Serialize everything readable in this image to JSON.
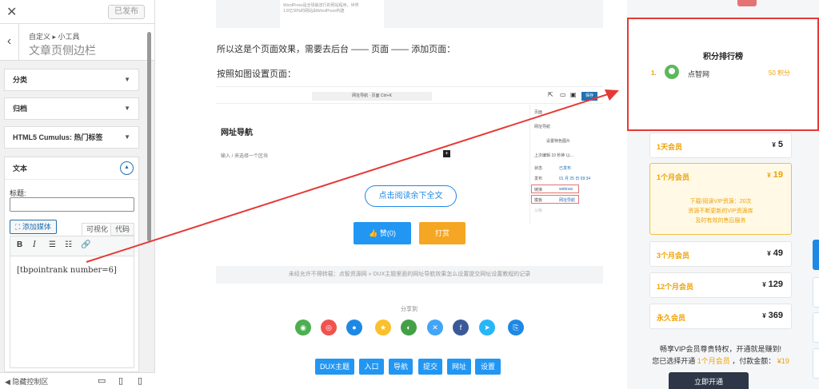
{
  "customizer": {
    "publish": "已发布",
    "breadcrumb": "自定义 ▸ 小工具",
    "title": "文章页侧边栏",
    "sections": [
      {
        "label": "分类"
      },
      {
        "label": "归档"
      },
      {
        "label": "HTML5 Cumulus: 热门标签"
      }
    ],
    "widget": {
      "name": "文本",
      "title_label": "标题:",
      "title_value": "",
      "add_media": "添加媒体",
      "tab_visual": "可视化",
      "tab_code": "代码",
      "content": "[tbpointrank number=6]"
    },
    "hide_controls": "隐藏控制区"
  },
  "article": {
    "snippet_line1": "WordPress是全球最流行的网站程序，世界",
    "snippet_line2": "1.8亿30%的网站由WordPress构建",
    "para1": "所以这是个页面效果，需要去后台 —— 页面 —— 添加页面：",
    "para2": "按照如图设置页面：",
    "shot": {
      "topbar": "网址导航 · 页面          Ctrl+K",
      "save": "保存",
      "page_title": "网址导航",
      "hint": "输入 / 来选择一个区块",
      "side_lines": [
        "页面",
        "网址导航",
        "设置特色图片",
        "上次编辑 10 秒钟 以...",
        "状态",
        "发布",
        "链接",
        "模板",
        "父级"
      ],
      "side_values": [
        "",
        "",
        "",
        "",
        "已发布",
        "01 月 25 日 09:34",
        "webnav",
        "网址导航",
        ""
      ]
    },
    "read_more": "点击阅读余下全文",
    "like": "赞(0)",
    "reward": "打赏",
    "notice": "未经允许不得转载：点智资源网 » DUX主题里面的网址导航效果怎么设置提交网址设置教程的记录",
    "share_label": "分享到",
    "tags": [
      "DUX主题",
      "入口",
      "导航",
      "提交",
      "网址",
      "设置"
    ]
  },
  "sidebar": {
    "rank_title": "积分排行榜",
    "rank_items": [
      {
        "num": "1.",
        "name": "点智网",
        "points": "50 积分"
      }
    ],
    "plans": [
      {
        "name": "1天会员",
        "price": "5"
      },
      {
        "name": "1个月会员",
        "price": "19",
        "desc": [
          "下载/阅读VIP资源：20次",
          "资源不断更新的VIP资源库",
          "及时有效的售后服务"
        ]
      },
      {
        "name": "3个月会员",
        "price": "49"
      },
      {
        "name": "12个月会员",
        "price": "129"
      },
      {
        "name": "永久会员",
        "price": "369"
      }
    ],
    "currency": "¥",
    "vip_line1": "畅享VIP会员尊贵特权，开通就是赚到!",
    "vip_line2_a": "您已选择开通",
    "vip_line2_plan": "1个月会员",
    "vip_line2_b": "，付款金额：",
    "vip_line2_amount": "¥19",
    "open_btn": "立即开通"
  },
  "colors": {
    "accent": "#2196f3",
    "gold": "#f0a000",
    "annotation_red": "#e53935"
  }
}
